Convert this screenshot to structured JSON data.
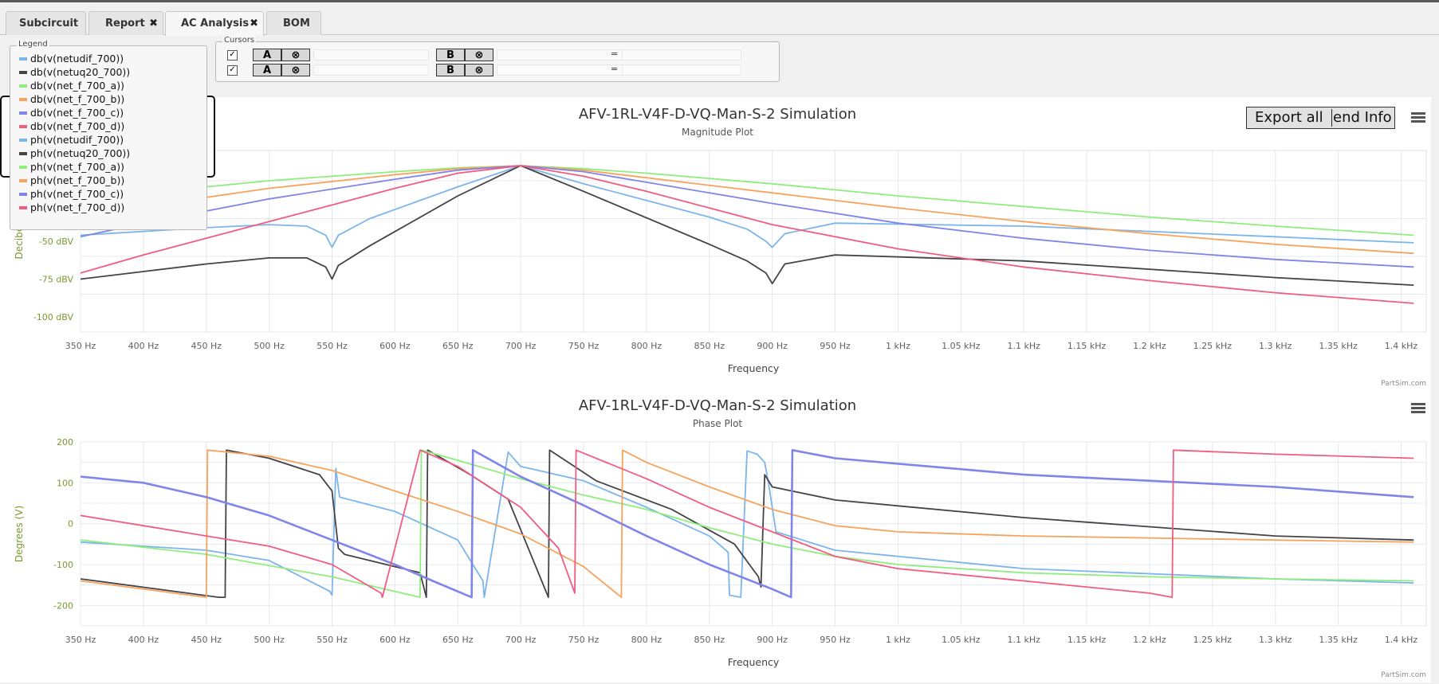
{
  "tabs": [
    {
      "label": "Subcircuit",
      "closable": false,
      "active": false
    },
    {
      "label": "Report",
      "closable": true,
      "active": false
    },
    {
      "label": "AC Analysis",
      "closable": true,
      "active": true
    },
    {
      "label": "BOM",
      "closable": false,
      "active": false
    }
  ],
  "legend": {
    "title": "Legend",
    "items": [
      {
        "label": "db(v(netudif_700))",
        "color": "#7cb5ec"
      },
      {
        "label": "db(v(netuq20_700))",
        "color": "#434348"
      },
      {
        "label": "db(v(net_f_700_a))",
        "color": "#90ed7d"
      },
      {
        "label": "db(v(net_f_700_b))",
        "color": "#f7a35c"
      },
      {
        "label": "db(v(net_f_700_c))",
        "color": "#8085e9"
      },
      {
        "label": "db(v(net_f_700_d))",
        "color": "#f15c80"
      },
      {
        "label": "ph(v(netudif_700))",
        "color": "#7cb5ec"
      },
      {
        "label": "ph(v(netuq20_700))",
        "color": "#434348"
      },
      {
        "label": "ph(v(net_f_700_a))",
        "color": "#90ed7d"
      },
      {
        "label": "ph(v(net_f_700_b))",
        "color": "#f7a35c"
      },
      {
        "label": "ph(v(net_f_700_c))",
        "color": "#8085e9"
      },
      {
        "label": "ph(v(net_f_700_d))",
        "color": "#f15c80"
      }
    ]
  },
  "cursors": {
    "title": "Cursors",
    "rows": [
      {
        "checked": true,
        "a_label": "A",
        "b_label": "B",
        "clear_symbol": "⊗",
        "equals": "="
      },
      {
        "checked": true,
        "a_label": "A",
        "b_label": "B",
        "clear_symbol": "⊗",
        "equals": "="
      }
    ]
  },
  "export": {
    "label_left": "Export all",
    "label_right": "end Info"
  },
  "credit": "PartSim.com",
  "chart_data": [
    {
      "type": "line",
      "title": "AFV-1RL-V4F-D-VQ-Man-S-2 Simulation",
      "subtitle": "Magnitude Plot",
      "xlabel": "Frequency",
      "ylabel": "Decibel",
      "xlim": [
        350,
        1420
      ],
      "ylim": [
        -110,
        10
      ],
      "yticks": [
        -100,
        -75,
        -50
      ],
      "ytick_labels": [
        "-100 dBV",
        "-75 dBV",
        "-50 dBV"
      ],
      "xticks": [
        350,
        400,
        450,
        500,
        550,
        600,
        650,
        700,
        750,
        800,
        850,
        900,
        950,
        1000,
        1050,
        1100,
        1150,
        1200,
        1250,
        1300,
        1350,
        1400
      ],
      "xtick_labels": [
        "350 Hz",
        "400 Hz",
        "450 Hz",
        "500 Hz",
        "550 Hz",
        "600 Hz",
        "650 Hz",
        "700 Hz",
        "750 Hz",
        "800 Hz",
        "850 Hz",
        "900 Hz",
        "950 Hz",
        "1 kHz",
        "1.05 kHz",
        "1.1 kHz",
        "1.15 kHz",
        "1.2 kHz",
        "1.25 kHz",
        "1.3 kHz",
        "1.35 kHz",
        "1.4 kHz"
      ],
      "grid": true,
      "series": [
        {
          "name": "db(v(netudif_700))",
          "color": "#7cb5ec",
          "x": [
            350,
            450,
            500,
            530,
            545,
            550,
            555,
            580,
            650,
            700,
            750,
            850,
            880,
            895,
            900,
            910,
            950,
            1100,
            1300,
            1410
          ],
          "y": [
            -46,
            -41,
            -39,
            -40,
            -46,
            -54,
            -46,
            -35,
            -14,
            0,
            -12,
            -34,
            -42,
            -50,
            -54,
            -45,
            -38,
            -40,
            -47,
            -51
          ]
        },
        {
          "name": "db(v(netuq20_700))",
          "color": "#434348",
          "x": [
            350,
            450,
            500,
            530,
            545,
            550,
            555,
            580,
            650,
            700,
            750,
            850,
            880,
            895,
            900,
            910,
            950,
            1100,
            1300,
            1410
          ],
          "y": [
            -75,
            -65,
            -61,
            -61,
            -67,
            -75,
            -66,
            -53,
            -20,
            0,
            -17,
            -52,
            -63,
            -71,
            -78,
            -65,
            -59,
            -63,
            -74,
            -79
          ]
        },
        {
          "name": "db(v(net_f_700_a))",
          "color": "#90ed7d",
          "x": [
            350,
            400,
            500,
            600,
            650,
            700,
            750,
            800,
            900,
            1000,
            1100,
            1200,
            1300,
            1410
          ],
          "y": [
            -24,
            -18,
            -10,
            -4,
            -1.5,
            0,
            -2,
            -5,
            -12,
            -20,
            -27,
            -34,
            -40,
            -46
          ]
        },
        {
          "name": "db(v(net_f_700_b))",
          "color": "#f7a35c",
          "x": [
            350,
            400,
            500,
            600,
            650,
            700,
            750,
            800,
            900,
            1000,
            1100,
            1200,
            1300,
            1410
          ],
          "y": [
            -34,
            -27,
            -15,
            -6,
            -2,
            0,
            -3,
            -8,
            -18,
            -28,
            -37,
            -45,
            -52,
            -58
          ]
        },
        {
          "name": "db(v(net_f_700_c))",
          "color": "#8085e9",
          "x": [
            350,
            400,
            500,
            600,
            650,
            700,
            750,
            800,
            900,
            1000,
            1100,
            1200,
            1300,
            1410
          ],
          "y": [
            -47,
            -38,
            -22,
            -9,
            -3,
            0,
            -4,
            -11,
            -25,
            -38,
            -48,
            -56,
            -62,
            -67
          ]
        },
        {
          "name": "db(v(net_f_700_d))",
          "color": "#f15c80",
          "x": [
            350,
            400,
            500,
            600,
            650,
            700,
            750,
            800,
            900,
            1000,
            1100,
            1200,
            1300,
            1410
          ],
          "y": [
            -71,
            -59,
            -37,
            -15,
            -5,
            0,
            -7,
            -17,
            -39,
            -55,
            -67,
            -76,
            -84,
            -91
          ]
        }
      ]
    },
    {
      "type": "line",
      "title": "AFV-1RL-V4F-D-VQ-Man-S-2 Simulation",
      "subtitle": "Phase Plot",
      "xlabel": "Frequency",
      "ylabel": "Degrees (V)",
      "xlim": [
        350,
        1420
      ],
      "ylim": [
        -250,
        200
      ],
      "yticks": [
        -200,
        -100,
        0,
        100,
        200
      ],
      "ytick_labels": [
        "-200",
        "-100",
        "0",
        "100",
        "200"
      ],
      "xticks": [
        350,
        400,
        450,
        500,
        550,
        600,
        650,
        700,
        750,
        800,
        850,
        900,
        950,
        1000,
        1050,
        1100,
        1150,
        1200,
        1250,
        1300,
        1350,
        1400
      ],
      "xtick_labels": [
        "350 Hz",
        "400 Hz",
        "450 Hz",
        "500 Hz",
        "550 Hz",
        "600 Hz",
        "650 Hz",
        "700 Hz",
        "750 Hz",
        "800 Hz",
        "850 Hz",
        "900 Hz",
        "950 Hz",
        "1 kHz",
        "1.05 kHz",
        "1.1 kHz",
        "1.15 kHz",
        "1.2 kHz",
        "1.25 kHz",
        "1.3 kHz",
        "1.35 kHz",
        "1.4 kHz"
      ],
      "grid": true,
      "series": [
        {
          "name": "ph(v(netudif_700))",
          "color": "#7cb5ec",
          "x": [
            350,
            450,
            500,
            548,
            550,
            553,
            556,
            600,
            650,
            670,
            671,
            690,
            700,
            750,
            800,
            850,
            865,
            866,
            875,
            880,
            888,
            894,
            897,
            903,
            950,
            1100,
            1300,
            1410
          ],
          "y": [
            -45,
            -65,
            -90,
            -165,
            -175,
            135,
            65,
            30,
            -40,
            -140,
            -180,
            175,
            140,
            105,
            40,
            -30,
            -70,
            -175,
            -180,
            178,
            170,
            150,
            100,
            -20,
            -65,
            -110,
            -135,
            -145
          ]
        },
        {
          "name": "ph(v(netuq20_700))",
          "color": "#434348",
          "x": [
            350,
            460,
            465,
            466,
            500,
            540,
            550,
            555,
            560,
            620,
            625,
            626,
            660,
            690,
            722,
            723,
            760,
            820,
            870,
            889,
            891,
            894,
            900,
            950,
            1100,
            1300,
            1410
          ],
          "y": [
            -135,
            -180,
            -180,
            180,
            160,
            120,
            80,
            -60,
            -75,
            -120,
            -180,
            180,
            120,
            60,
            -180,
            180,
            105,
            35,
            -50,
            -130,
            -155,
            120,
            90,
            58,
            15,
            -30,
            -40
          ]
        },
        {
          "name": "ph(v(net_f_700_a))",
          "color": "#90ed7d",
          "x": [
            350,
            450,
            550,
            620,
            621,
            650,
            700,
            750,
            800,
            850,
            900,
            950,
            1000,
            1100,
            1200,
            1300,
            1410
          ],
          "y": [
            -40,
            -75,
            -130,
            -180,
            180,
            155,
            110,
            70,
            35,
            -10,
            -50,
            -80,
            -100,
            -120,
            -130,
            -135,
            -140
          ]
        },
        {
          "name": "ph(v(net_f_700_b))",
          "color": "#f7a35c",
          "x": [
            350,
            450,
            451,
            500,
            550,
            600,
            650,
            700,
            750,
            780,
            781,
            800,
            850,
            900,
            950,
            1000,
            1100,
            1200,
            1300,
            1410
          ],
          "y": [
            -140,
            -180,
            180,
            165,
            130,
            80,
            30,
            -25,
            -105,
            -180,
            180,
            150,
            90,
            35,
            -5,
            -20,
            -30,
            -35,
            -40,
            -45
          ]
        },
        {
          "name": "ph(v(net_f_700_c))",
          "color": "#8085e9",
          "x": [
            350,
            400,
            450,
            500,
            550,
            600,
            630,
            661,
            662,
            700,
            750,
            800,
            850,
            900,
            915,
            916,
            950,
            1100,
            1300,
            1410
          ],
          "y": [
            115,
            100,
            65,
            20,
            -40,
            -100,
            -140,
            -180,
            180,
            115,
            45,
            -30,
            -100,
            -160,
            -180,
            180,
            160,
            120,
            90,
            65
          ]
        },
        {
          "name": "ph(v(net_f_700_d))",
          "color": "#f15c80",
          "x": [
            350,
            400,
            450,
            500,
            550,
            589,
            590,
            620,
            650,
            700,
            730,
            743,
            744,
            800,
            850,
            900,
            950,
            1000,
            1100,
            1200,
            1218,
            1219,
            1300,
            1410
          ],
          "y": [
            20,
            -5,
            -30,
            -55,
            -100,
            -170,
            -180,
            180,
            140,
            40,
            -60,
            -170,
            180,
            110,
            40,
            -20,
            -80,
            -110,
            -140,
            -170,
            -180,
            180,
            170,
            160
          ]
        }
      ]
    }
  ]
}
